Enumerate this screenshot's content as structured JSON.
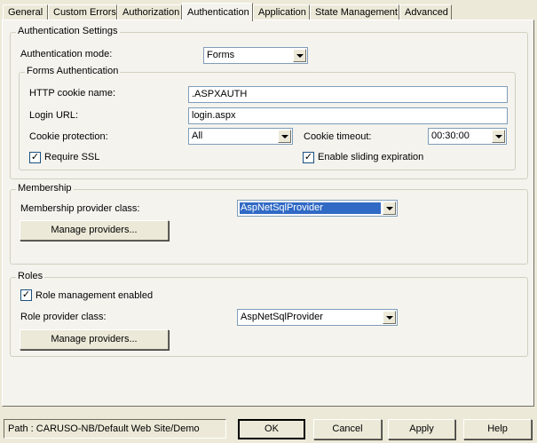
{
  "tabs": [
    "General",
    "Custom Errors",
    "Authorization",
    "Authentication",
    "Application",
    "State Management",
    "Advanced"
  ],
  "authentication_settings": {
    "legend": "Authentication Settings",
    "mode_label": "Authentication mode:",
    "mode_value": "Forms"
  },
  "forms": {
    "legend": "Forms Authentication",
    "cookie_name_label": "HTTP cookie name:",
    "cookie_name_value": ".ASPXAUTH",
    "login_url_label": "Login URL:",
    "login_url_value": "login.aspx",
    "protection_label": "Cookie protection:",
    "protection_value": "All",
    "timeout_label": "Cookie timeout:",
    "timeout_value": "00:30:00",
    "require_ssl_label": "Require SSL",
    "require_ssl_checked": true,
    "sliding_label": "Enable sliding expiration",
    "sliding_checked": true
  },
  "membership": {
    "legend": "Membership",
    "provider_label": "Membership provider class:",
    "provider_value": "AspNetSqlProvider",
    "manage_label": "Manage providers..."
  },
  "roles": {
    "legend": "Roles",
    "enabled_label": "Role management enabled",
    "enabled_checked": true,
    "provider_label": "Role provider class:",
    "provider_value": "AspNetSqlProvider",
    "manage_label": "Manage providers..."
  },
  "footer": {
    "path": "Path : CARUSO-NB/Default Web Site/Demo",
    "ok": "OK",
    "cancel": "Cancel",
    "apply": "Apply",
    "help": "Help"
  },
  "colors": {
    "dialog_bg": "#ece9d8",
    "panel_bg": "#f4f3ee",
    "selection": "#316ac5"
  }
}
